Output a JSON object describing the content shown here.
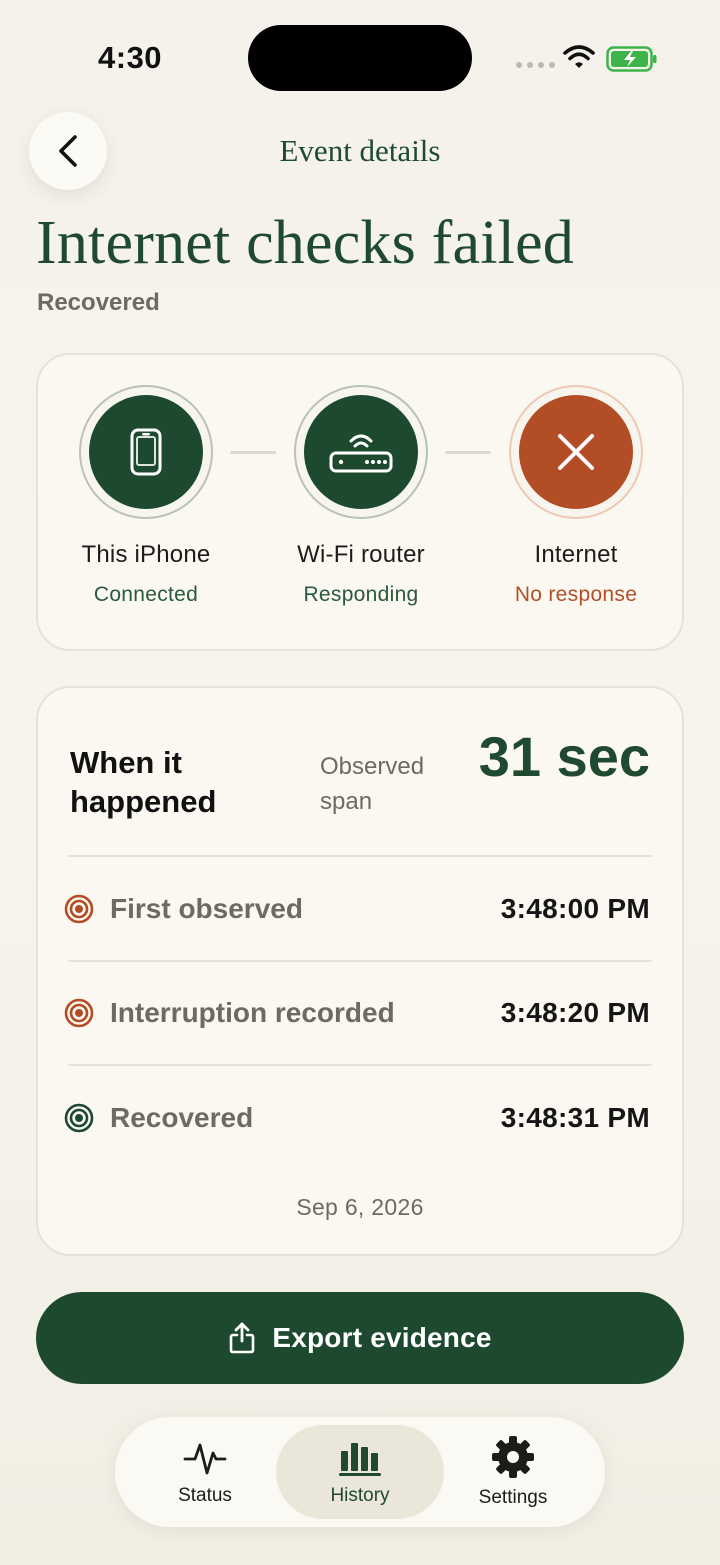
{
  "status_bar": {
    "time": "4:30"
  },
  "nav": {
    "title": "Event details"
  },
  "header": {
    "title": "Internet checks failed",
    "subtitle": "Recovered"
  },
  "path": {
    "nodes": [
      {
        "label": "This iPhone",
        "status": "Connected",
        "icon": "iphone-icon",
        "state": "ok"
      },
      {
        "label": "Wi-Fi router",
        "status": "Responding",
        "icon": "router-icon",
        "state": "ok"
      },
      {
        "label": "Internet",
        "status": "No response",
        "icon": "x-icon",
        "state": "fail"
      }
    ]
  },
  "timeline": {
    "title": "When it happened",
    "span_label": "Observed span",
    "span_value": "31 sec",
    "events": [
      {
        "label": "First observed",
        "time": "3:48:00 PM",
        "icon": "target-icon",
        "color": "#b24d26"
      },
      {
        "label": "Interruption recorded",
        "time": "3:48:20 PM",
        "icon": "target-icon",
        "color": "#b24d26"
      },
      {
        "label": "Recovered",
        "time": "3:48:31 PM",
        "icon": "target-icon",
        "color": "#1d4a2f"
      }
    ],
    "date": "Sep 6, 2026"
  },
  "export": {
    "label": "Export evidence"
  },
  "tabs": [
    {
      "label": "Status",
      "icon": "pulse-icon"
    },
    {
      "label": "History",
      "icon": "bar-chart-icon"
    },
    {
      "label": "Settings",
      "icon": "gear-icon"
    }
  ],
  "colors": {
    "accent": "#1d4a2f",
    "error": "#b24d26",
    "background": "#f4f2ea"
  }
}
